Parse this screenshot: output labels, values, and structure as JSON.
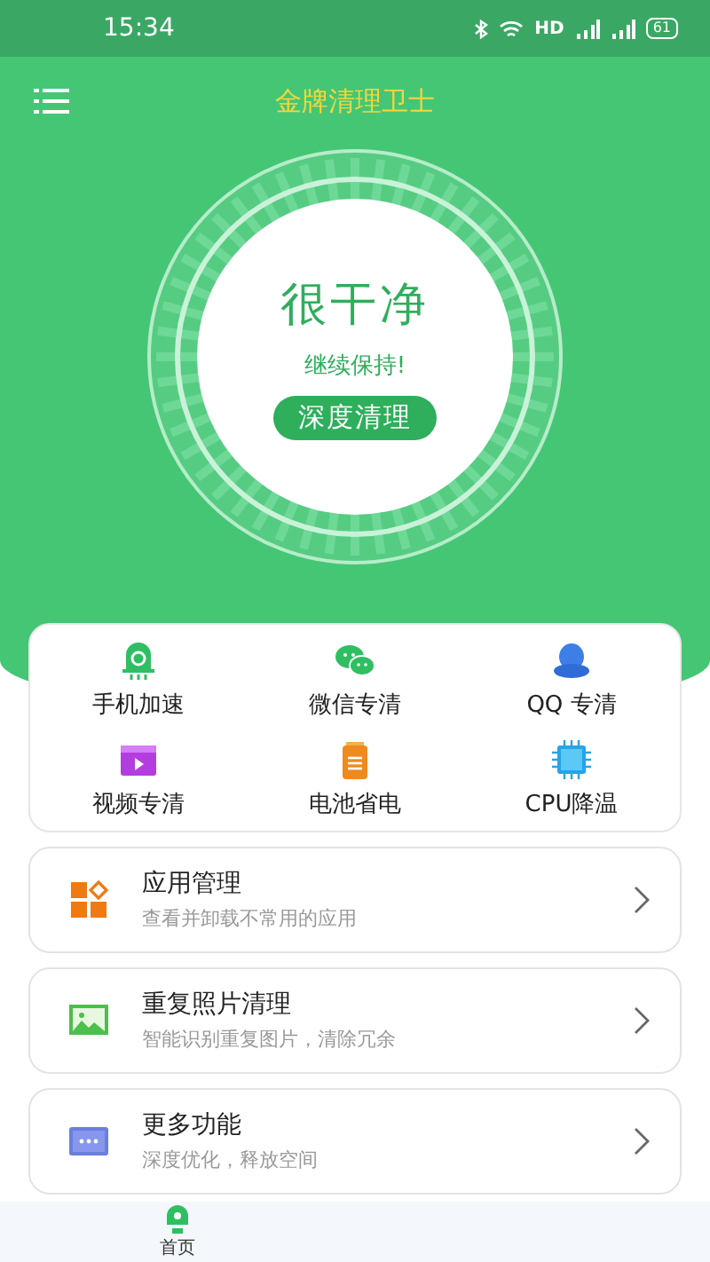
{
  "status_bar": {
    "time": "15:34",
    "network": "HD",
    "battery": "61"
  },
  "header": {
    "title": "金牌清理卫士"
  },
  "cleaner": {
    "status": "很干净",
    "message": "继续保持!",
    "button": "深度清理"
  },
  "tools": [
    {
      "label": "手机加速",
      "kind": "rocket"
    },
    {
      "label": "微信专清",
      "kind": "chat"
    },
    {
      "label": "QQ 专清",
      "kind": "penguin"
    },
    {
      "label": "视频专清",
      "kind": "video"
    },
    {
      "label": "电池省电",
      "kind": "battery"
    },
    {
      "label": "CPU降温",
      "kind": "chip"
    }
  ],
  "features": [
    {
      "title": "应用管理",
      "subtitle": "查看并卸载不常用的应用",
      "kind": "apps"
    },
    {
      "title": "重复照片清理",
      "subtitle": "智能识别重复图片，清除冗余",
      "kind": "photo"
    },
    {
      "title": "更多功能",
      "subtitle": "深度优化，释放空间",
      "kind": "more"
    }
  ],
  "bottom_nav": [
    {
      "label": "首页",
      "selected": true
    }
  ]
}
